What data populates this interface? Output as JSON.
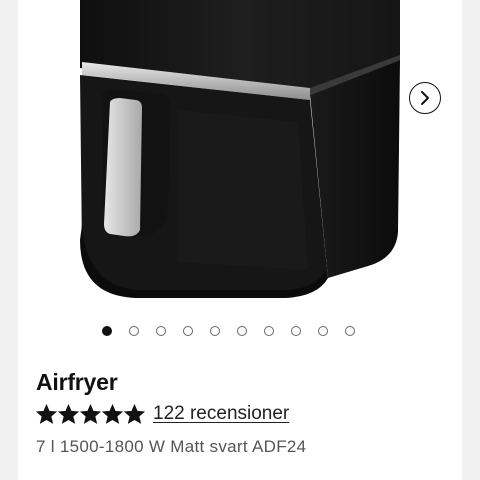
{
  "product": {
    "title": "Airfryer",
    "rating_value": 5,
    "rating_max": 5,
    "reviews_text": "122 recensioner",
    "subtitle": "7 l 1500-1800 W Matt svart ADF24"
  },
  "gallery": {
    "image_name": "airfryer-photo",
    "dot_count": 10,
    "active_index": 0,
    "next_icon": "chevron-right-icon"
  },
  "colors": {
    "appliance_body": "#1b1b1b",
    "handle": "#c9c9c9",
    "accent_text": "#111111",
    "muted_text": "#555555"
  }
}
